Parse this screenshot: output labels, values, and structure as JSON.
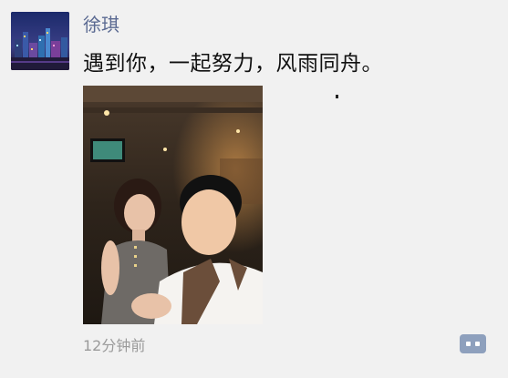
{
  "post": {
    "author": "徐琪",
    "text": "遇到你，一起努力，风雨同舟。",
    "timestamp": "12分钟前"
  },
  "icons": {
    "avatar": "city-night-skyline",
    "comment_button": "comment-dots-icon"
  },
  "colors": {
    "author_name": "#5b6a92",
    "timestamp": "#9a9a9a",
    "comment_button": "#8ea0bd",
    "background": "#f1f1f1"
  }
}
